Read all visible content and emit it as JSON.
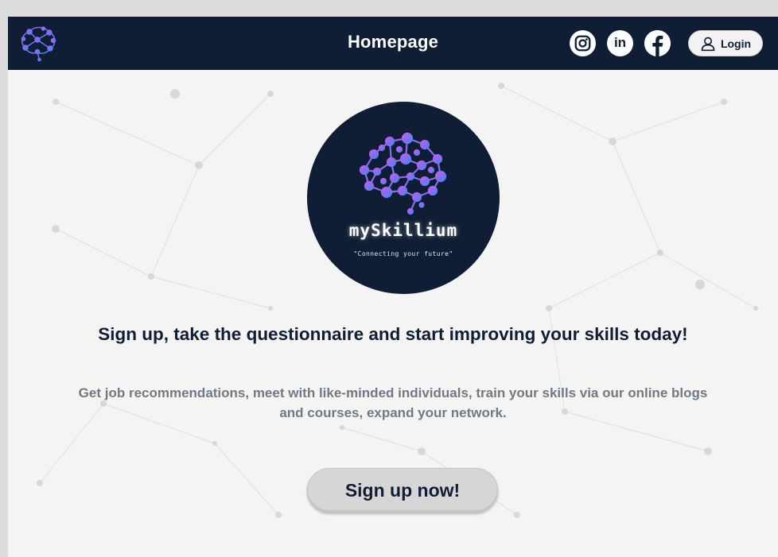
{
  "navbar": {
    "title": "Homepage",
    "logo_icon": "brain-network-icon",
    "social": [
      {
        "name": "instagram",
        "icon": "instagram-icon"
      },
      {
        "name": "linkedin",
        "icon": "linkedin-icon",
        "glyph": "in"
      },
      {
        "name": "facebook",
        "icon": "facebook-icon"
      }
    ],
    "login_label": "Login",
    "login_icon": "user-icon"
  },
  "hero": {
    "brand_name": "mySkillium",
    "tagline": "\"Connecting your future\"",
    "logo_icon": "brain-network-icon"
  },
  "content": {
    "headline": "Sign up, take the questionnaire and start improving your skills today!",
    "subtext": "Get job recommendations, meet with like-minded individuals, train your skills via our online blogs and courses, expand your network.",
    "cta_label": "Sign up now!"
  },
  "colors": {
    "navy": "#0f1e34",
    "brain_purple": "#a35cf0",
    "brain_blue": "#3b8ff2",
    "subtext_gray": "#6e7a86",
    "button_gray": "#d6d6d6"
  }
}
